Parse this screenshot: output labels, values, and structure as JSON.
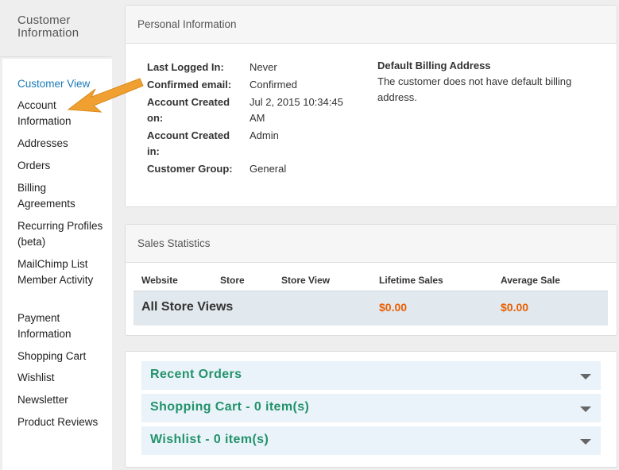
{
  "sidebar": {
    "title": "Customer Information",
    "items": [
      {
        "label": "Customer View",
        "active": true
      },
      {
        "label": "Account Information"
      },
      {
        "label": "Addresses"
      },
      {
        "label": "Orders"
      },
      {
        "label": "Billing Agreements"
      },
      {
        "label": "Recurring Profiles (beta)"
      },
      {
        "label": "MailChimp List Member Activity"
      },
      {
        "label": "Payment Information"
      },
      {
        "label": "Shopping Cart"
      },
      {
        "label": "Wishlist"
      },
      {
        "label": "Newsletter"
      },
      {
        "label": "Product Reviews"
      }
    ]
  },
  "personal_info": {
    "heading": "Personal Information",
    "rows": [
      {
        "label": "Last Logged In:",
        "value": "Never"
      },
      {
        "label": "Confirmed email:",
        "value": "Confirmed"
      },
      {
        "label": "Account Created on:",
        "value": "Jul 2, 2015 10:34:45 AM"
      },
      {
        "label": "Account Created in:",
        "value": "Admin"
      },
      {
        "label": "Customer Group:",
        "value": "General"
      }
    ],
    "billing_heading": "Default Billing Address",
    "billing_text": "The customer does not have default billing address."
  },
  "sales_statistics": {
    "heading": "Sales Statistics",
    "columns": [
      "Website",
      "Store",
      "Store View",
      "Lifetime Sales",
      "Average Sale"
    ],
    "total_row": {
      "label": "All Store Views",
      "lifetime_sales": "$0.00",
      "average_sale": "$0.00"
    }
  },
  "accordion": {
    "items": [
      {
        "label": "Recent Orders"
      },
      {
        "label": "Shopping Cart - 0 item(s)"
      },
      {
        "label": "Wishlist - 0 item(s)"
      }
    ]
  },
  "colors": {
    "link": "#1a7ab8",
    "money": "#eb5e00",
    "accordion_title": "#23926b",
    "annotation_arrow": "#f0a030"
  }
}
